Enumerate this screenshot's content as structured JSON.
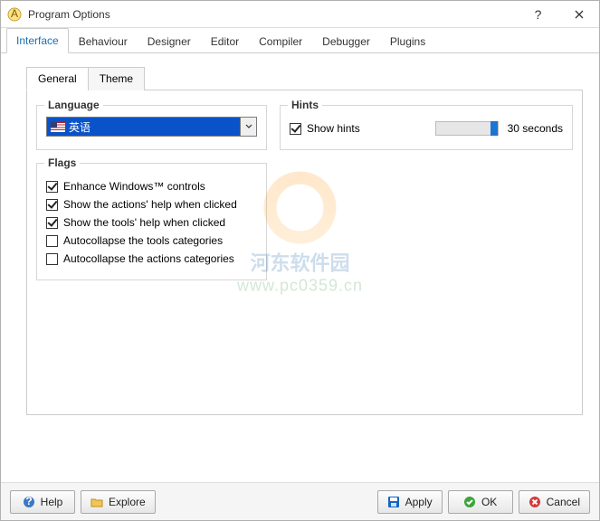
{
  "window": {
    "title": "Program Options"
  },
  "tabs": {
    "items": [
      "Interface",
      "Behaviour",
      "Designer",
      "Editor",
      "Compiler",
      "Debugger",
      "Plugins"
    ],
    "active": 0
  },
  "subtabs": {
    "items": [
      "General",
      "Theme"
    ],
    "active": 0
  },
  "language": {
    "legend": "Language",
    "value": "英语"
  },
  "hints": {
    "legend": "Hints",
    "show_label": "Show hints",
    "show_checked": true,
    "slider_value": 30,
    "slider_max": 30,
    "value_label": "30 seconds"
  },
  "flags": {
    "legend": "Flags",
    "items": [
      {
        "label": "Enhance Windows™ controls",
        "checked": true
      },
      {
        "label": "Show the actions' help when clicked",
        "checked": true
      },
      {
        "label": "Show the tools' help when clicked",
        "checked": true
      },
      {
        "label": "Autocollapse the tools categories",
        "checked": false
      },
      {
        "label": "Autocollapse the actions categories",
        "checked": false
      }
    ]
  },
  "buttons": {
    "help": "Help",
    "explore": "Explore",
    "apply": "Apply",
    "ok": "OK",
    "cancel": "Cancel"
  },
  "watermark": {
    "line1": "河东软件园",
    "line2": "www.pc0359.cn"
  },
  "colors": {
    "accent": "#0a52c8",
    "ok": "#3aa53a",
    "cancel": "#d23b3b",
    "apply": "#1565c0"
  }
}
